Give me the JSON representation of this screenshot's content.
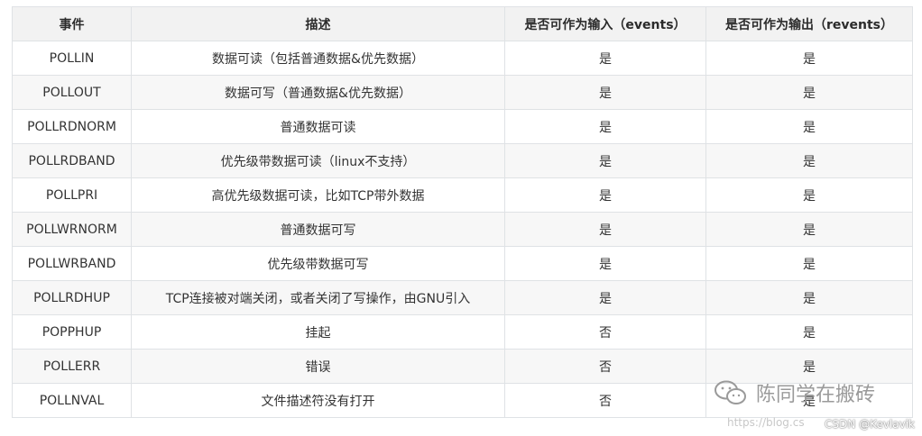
{
  "table": {
    "headers": [
      "事件",
      "描述",
      "是否可作为输入（events）",
      "是否可作为输出（revents）"
    ],
    "rows": [
      {
        "event": "POLLIN",
        "desc": "数据可读（包括普通数据&优先数据）",
        "input": "是",
        "output": "是"
      },
      {
        "event": "POLLOUT",
        "desc": "数据可写（普通数据&优先数据）",
        "input": "是",
        "output": "是"
      },
      {
        "event": "POLLRDNORM",
        "desc": "普通数据可读",
        "input": "是",
        "output": "是"
      },
      {
        "event": "POLLRDBAND",
        "desc": "优先级带数据可读（linux不支持）",
        "input": "是",
        "output": "是"
      },
      {
        "event": "POLLPRI",
        "desc": "高优先级数据可读，比如TCP带外数据",
        "input": "是",
        "output": "是"
      },
      {
        "event": "POLLWRNORM",
        "desc": "普通数据可写",
        "input": "是",
        "output": "是"
      },
      {
        "event": "POLLWRBAND",
        "desc": "优先级带数据可写",
        "input": "是",
        "output": "是"
      },
      {
        "event": "POLLRDHUP",
        "desc": "TCP连接被对端关闭，或者关闭了写操作，由GNU引入",
        "input": "是",
        "output": "是"
      },
      {
        "event": "POPPHUP",
        "desc": "挂起",
        "input": "否",
        "output": "是"
      },
      {
        "event": "POLLERR",
        "desc": "错误",
        "input": "否",
        "output": "是"
      },
      {
        "event": "POLLNVAL",
        "desc": "文件描述符没有打开",
        "input": "否",
        "output": "是"
      }
    ]
  },
  "watermark": {
    "text": "陈同学在搬砖",
    "icon": "wechat-icon",
    "url": "https://blog.cs",
    "csdn": "CSDN @Kevlavik"
  },
  "colors": {
    "header_bg": "#f2f2f2",
    "border": "#dfe2e5",
    "stripe": "#f7f7f7"
  }
}
